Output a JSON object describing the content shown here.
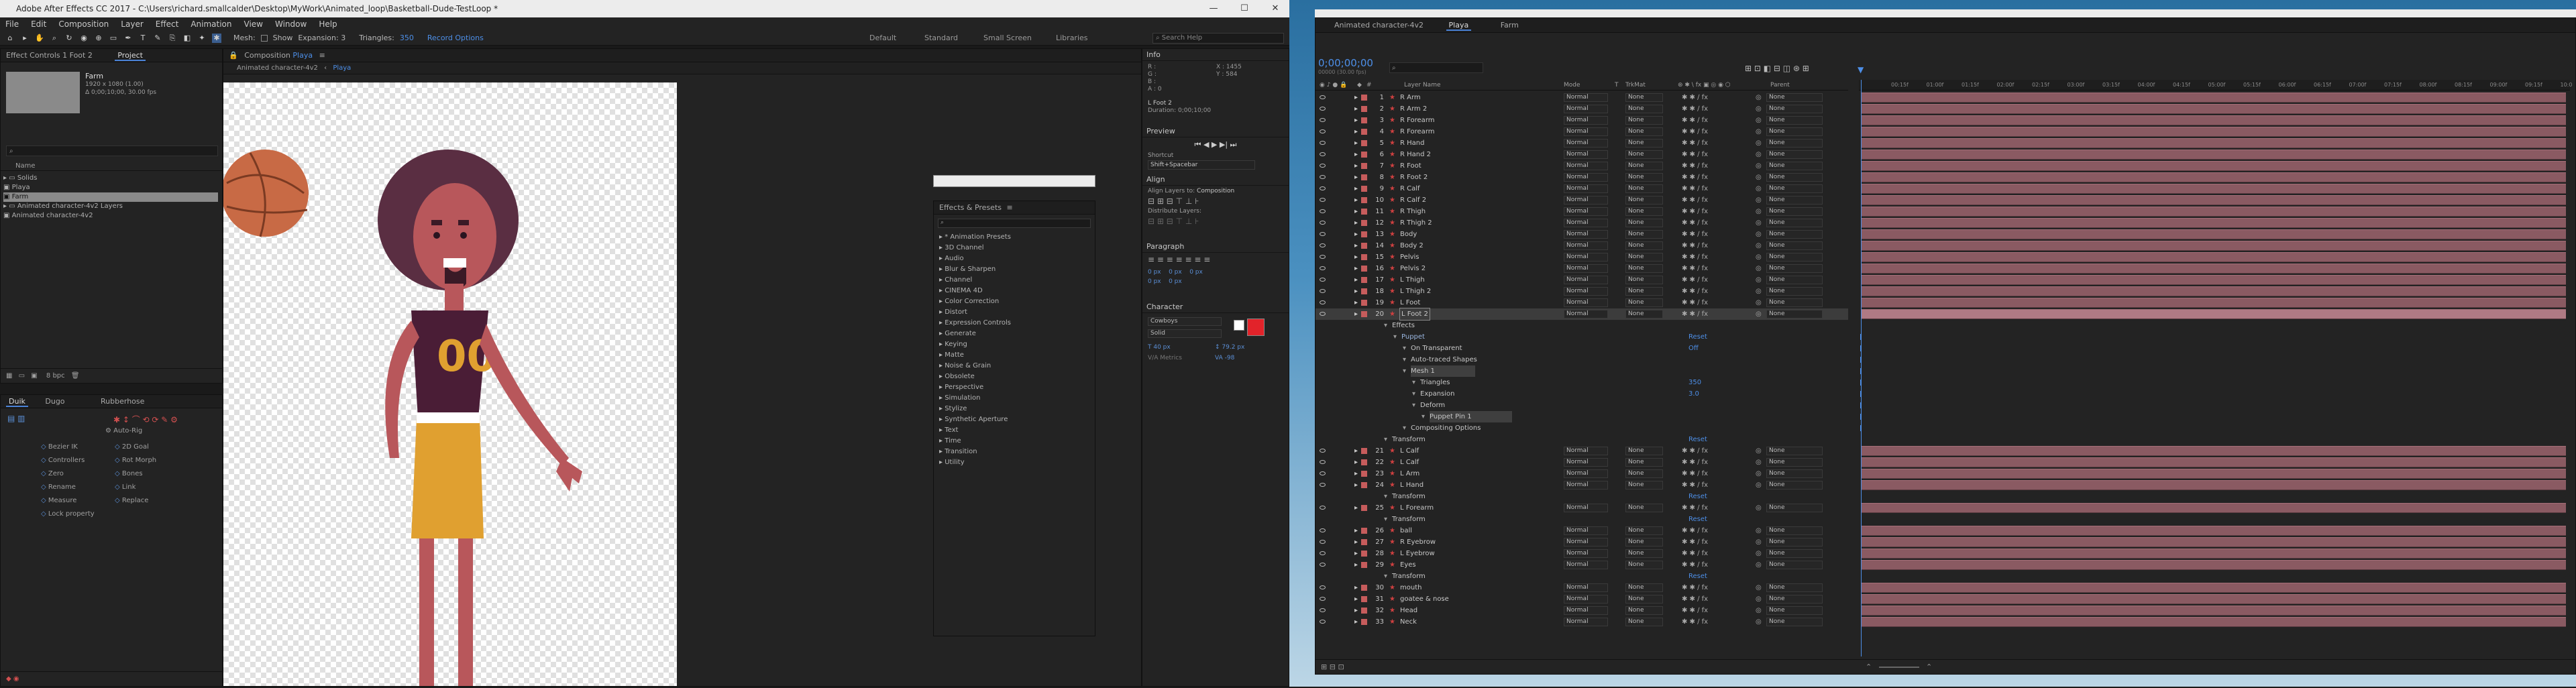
{
  "app": {
    "title": "Adobe After Effects CC 2017 - C:\\Users\\richard.smallcalder\\Desktop\\MyWork\\Animated_loop\\Basketball-Dude-TestLoop *",
    "menu": [
      "File",
      "Edit",
      "Composition",
      "Layer",
      "Effect",
      "Animation",
      "View",
      "Window",
      "Help"
    ],
    "toolbar": {
      "mesh_label": "Mesh:",
      "show_label": "Show",
      "expansion": "Expansion: 3",
      "triangles_label": "Triangles:",
      "triangles_value": "350",
      "record_options": "Record Options",
      "workspaces": [
        "Default",
        "Standard",
        "Small Screen",
        "Libraries"
      ],
      "search_placeholder": "Search Help"
    },
    "tool_icons": [
      "home-icon",
      "select-icon",
      "hand-icon",
      "zoom-icon",
      "rotate-icon",
      "camera-icon",
      "pan-behind-icon",
      "rect-mask-icon",
      "pen-icon",
      "type-icon",
      "brush-icon",
      "clone-icon",
      "eraser-icon",
      "roto-icon",
      "puppet-pin-icon"
    ]
  },
  "project": {
    "tabs": [
      "Effect Controls 1 Foot 2",
      "Project"
    ],
    "selected_name": "Farm",
    "selected_info": [
      "1920 x 1080 (1.00)",
      "Δ 0;00;10;00, 30.00 fps"
    ],
    "name_header": "Name",
    "items": [
      {
        "name": "Solids",
        "type": "folder"
      },
      {
        "name": "Playa",
        "type": "comp"
      },
      {
        "name": "Farm",
        "type": "comp",
        "selected": true
      },
      {
        "name": "Animated character-4v2 Layers",
        "type": "folder"
      },
      {
        "name": "Animated character-4v2",
        "type": "comp"
      }
    ],
    "bpc": "8 bpc"
  },
  "duik": {
    "tabs": [
      "Duik",
      "Dugo",
      "Rubberhose"
    ],
    "autorig": "Auto-Rig",
    "items": [
      "Bezier IK",
      "2D Goal",
      "Controllers",
      "Rot Morph",
      "Zero",
      "Bones",
      "Rename",
      "Link",
      "Measure",
      "Replace",
      "Lock property"
    ]
  },
  "composition": {
    "tab": "Composition",
    "comp_name": "Playa",
    "breadcrumbs": [
      "Animated character-4v2",
      "Playa"
    ],
    "jersey_number": "00"
  },
  "info_panel": {
    "title": "Info",
    "r": "R :",
    "g": "G :",
    "b": "B :",
    "a": "A : 0",
    "x": "X : 1455",
    "y": "Y : 584",
    "layer": "L Foot 2",
    "duration": "Duration: 0;00;10;00"
  },
  "preview": {
    "title": "Preview",
    "shortcut_label": "Shortcut",
    "shortcut_value": "Shift+Spacebar"
  },
  "align": {
    "title": "Align",
    "align_layers_to": "Align Layers to:",
    "target": "Composition",
    "distribute": "Distribute Layers:"
  },
  "paragraph": {
    "title": "Paragraph",
    "values": [
      "0 px",
      "0 px",
      "0 px",
      "0 px",
      "0 px"
    ]
  },
  "character": {
    "title": "Character",
    "font": "Cowboys",
    "style": "Solid",
    "size": "40 px",
    "leading": "79.2 px",
    "tracking": "Metrics",
    "kerning": "-98",
    "fill_color": "#e2232a"
  },
  "effects_presets": {
    "title": "Effects & Presets",
    "items": [
      "* Animation Presets",
      "3D Channel",
      "Audio",
      "Blur & Sharpen",
      "Channel",
      "CINEMA 4D",
      "Color Correction",
      "Distort",
      "Expression Controls",
      "Generate",
      "Keying",
      "Matte",
      "Noise & Grain",
      "Obsolete",
      "Perspective",
      "Simulation",
      "Stylize",
      "Synthetic Aperture",
      "Text",
      "Time",
      "Transition",
      "Utility"
    ]
  },
  "timeline": {
    "tabs": [
      "Animated character-4v2",
      "Playa",
      "Farm"
    ],
    "active_tab": "Playa",
    "timecode": "0;00;00;00",
    "fps_note": "00000 (30.00 fps)",
    "col_layer_name": "Layer Name",
    "col_mode": "Mode",
    "col_t": "T",
    "col_trkmat": "TrkMat",
    "col_parent": "Parent",
    "ruler": [
      "00:15f",
      "01:00f",
      "01:15f",
      "02:00f",
      "02:15f",
      "03:00f",
      "03:15f",
      "04:00f",
      "04:15f",
      "05:00f",
      "05:15f",
      "06:00f",
      "06:15f",
      "07:00f",
      "07:15f",
      "08:00f",
      "08:15f",
      "09:00f",
      "09:15f",
      "10:0"
    ],
    "mode": "Normal",
    "trkmat": "None",
    "parent": "None",
    "reset": "Reset",
    "rows": [
      {
        "kind": "layer",
        "num": "1",
        "name": "R Arm"
      },
      {
        "kind": "layer",
        "num": "2",
        "name": "R Arm 2"
      },
      {
        "kind": "layer",
        "num": "3",
        "name": "R Forearm"
      },
      {
        "kind": "layer",
        "num": "4",
        "name": "R Forearm"
      },
      {
        "kind": "layer",
        "num": "5",
        "name": "R Hand"
      },
      {
        "kind": "layer",
        "num": "6",
        "name": "R Hand 2"
      },
      {
        "kind": "layer",
        "num": "7",
        "name": "R Foot"
      },
      {
        "kind": "layer",
        "num": "8",
        "name": "R Foot 2"
      },
      {
        "kind": "layer",
        "num": "9",
        "name": "R Calf"
      },
      {
        "kind": "layer",
        "num": "10",
        "name": "R Calf 2"
      },
      {
        "kind": "layer",
        "num": "11",
        "name": "R Thigh"
      },
      {
        "kind": "layer",
        "num": "12",
        "name": "R Thigh 2"
      },
      {
        "kind": "layer",
        "num": "13",
        "name": "Body"
      },
      {
        "kind": "layer",
        "num": "14",
        "name": "Body 2"
      },
      {
        "kind": "layer",
        "num": "15",
        "name": "Pelvis"
      },
      {
        "kind": "layer",
        "num": "16",
        "name": "Pelvis 2"
      },
      {
        "kind": "layer",
        "num": "17",
        "name": "L Thigh"
      },
      {
        "kind": "layer",
        "num": "18",
        "name": "L Thigh 2"
      },
      {
        "kind": "layer",
        "num": "19",
        "name": "L Foot"
      },
      {
        "kind": "layer",
        "num": "20",
        "name": "L Foot 2",
        "selected": true
      },
      {
        "kind": "prop",
        "indent": 1,
        "name": "Effects"
      },
      {
        "kind": "prop",
        "indent": 2,
        "name": "Puppet",
        "value": "Reset",
        "blue": true
      },
      {
        "kind": "prop",
        "indent": 3,
        "name": "On Transparent",
        "value": "Off"
      },
      {
        "kind": "prop",
        "indent": 3,
        "name": "Auto-traced Shapes"
      },
      {
        "kind": "prop",
        "indent": 3,
        "name": "Mesh 1",
        "hl": true
      },
      {
        "kind": "prop",
        "indent": 4,
        "name": "Triangles",
        "value": "350"
      },
      {
        "kind": "prop",
        "indent": 4,
        "name": "Expansion",
        "value": "3.0"
      },
      {
        "kind": "prop",
        "indent": 4,
        "name": "Deform"
      },
      {
        "kind": "prop",
        "indent": 5,
        "name": "Puppet Pin 1",
        "hl": true
      },
      {
        "kind": "prop",
        "indent": 3,
        "name": "Compositing Options"
      },
      {
        "kind": "prop",
        "indent": 1,
        "name": "Transform",
        "value": "Reset"
      },
      {
        "kind": "layer",
        "num": "21",
        "name": "L Calf"
      },
      {
        "kind": "layer",
        "num": "22",
        "name": "L Calf"
      },
      {
        "kind": "layer",
        "num": "23",
        "name": "L Arm"
      },
      {
        "kind": "layer",
        "num": "24",
        "name": "L Hand"
      },
      {
        "kind": "prop",
        "indent": 1,
        "name": "Transform",
        "value": "Reset"
      },
      {
        "kind": "layer",
        "num": "25",
        "name": "L Forearm"
      },
      {
        "kind": "prop",
        "indent": 1,
        "name": "Transform",
        "value": "Reset"
      },
      {
        "kind": "layer",
        "num": "26",
        "name": "ball"
      },
      {
        "kind": "layer",
        "num": "27",
        "name": "R Eyebrow"
      },
      {
        "kind": "layer",
        "num": "28",
        "name": "L Eyebrow"
      },
      {
        "kind": "layer",
        "num": "29",
        "name": "Eyes"
      },
      {
        "kind": "prop",
        "indent": 1,
        "name": "Transform",
        "value": "Reset"
      },
      {
        "kind": "layer",
        "num": "30",
        "name": "mouth"
      },
      {
        "kind": "layer",
        "num": "31",
        "name": "goatee & nose"
      },
      {
        "kind": "layer",
        "num": "32",
        "name": "Head"
      },
      {
        "kind": "layer",
        "num": "33",
        "name": "Neck"
      }
    ]
  },
  "colors": {
    "accent": "#4a82d6",
    "label_red": "#c65c5c",
    "bar": "#8a5a62",
    "skin": "#b8575b",
    "hair": "#5a2e42",
    "jersey": "#4a1d36",
    "shorts": "#e0a030"
  }
}
